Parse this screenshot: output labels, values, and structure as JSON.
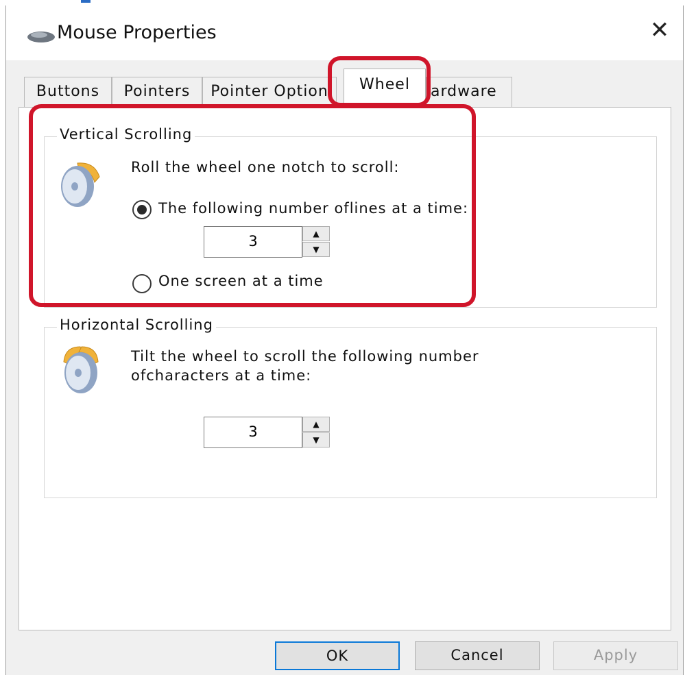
{
  "window": {
    "title": "Mouse Properties",
    "close_glyph": "✕"
  },
  "tabs": [
    {
      "label": "Buttons",
      "active": false
    },
    {
      "label": "Pointers",
      "active": false
    },
    {
      "label": "Pointer Option",
      "active": false
    },
    {
      "label": "Wheel",
      "active": true
    },
    {
      "label": "ardware",
      "active": false
    }
  ],
  "vertical": {
    "title": "Vertical Scrolling",
    "instruction": "Roll the wheel one notch to scroll:",
    "option_lines_label": "The following number oflines at a time:",
    "lines_value": "3",
    "option_screen_label": "One screen at a time",
    "selected_option": "lines"
  },
  "horizontal": {
    "title": "Horizontal Scrolling",
    "instruction_line1": "Tilt the wheel to scroll the following number",
    "instruction_line2": "ofcharacters at a time:",
    "chars_value": "3"
  },
  "buttons": {
    "ok": "OK",
    "cancel": "Cancel",
    "apply": "Apply"
  },
  "icons": {
    "app": "mouse-icon",
    "spin_up": "▲",
    "spin_down": "▼"
  },
  "colors": {
    "highlight": "#d0152a",
    "focus_border": "#0a78d7"
  }
}
